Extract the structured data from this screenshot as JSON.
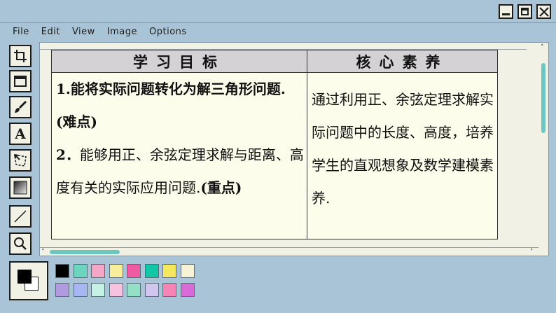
{
  "menu": [
    "File",
    "Edit",
    "View",
    "Image",
    "Options"
  ],
  "tools": [
    {
      "name": "select-tool",
      "icon": "crop-icon"
    },
    {
      "name": "rectangle-tool",
      "icon": "rectangle-icon"
    },
    {
      "name": "brush-tool",
      "icon": "brush-icon"
    },
    {
      "name": "text-tool",
      "icon": "text-icon",
      "glyph": "A"
    },
    {
      "name": "polygon-select-tool",
      "icon": "polygon-select-icon"
    },
    {
      "name": "gradient-tool",
      "icon": "gradient-icon"
    },
    {
      "name": "line-tool",
      "icon": "line-icon"
    },
    {
      "name": "zoom-tool",
      "icon": "magnifier-icon"
    }
  ],
  "slide": {
    "header_left": "学习目标",
    "header_right": "核心素养",
    "goal1_text": "1.能将实际问题转化为解三角形问题.",
    "goal1_tag": "(难点)",
    "goal2_num": "2．",
    "goal2_text": "能够用正、余弦定理求解与距离、高度有关的实际应用问题.",
    "goal2_tag": "(重点)",
    "core_text": "通过利用正、余弦定理求解实际问题中的长度、高度，培养学生的直观想象及数学建模素养."
  },
  "palette": {
    "foreground": "#000000",
    "background": "#ffffff",
    "colors_row1": [
      "#000000",
      "#6ad6c0",
      "#f4a6c6",
      "#f6ee9c",
      "#ee5ba0",
      "#12c7a3",
      "#f6e85e",
      "#f7f2d5"
    ],
    "colors_row2": [
      "#b29ae0",
      "#a9b6f4",
      "#c5f2e4",
      "#f6c2dd",
      "#93e0c6",
      "#d2c6f0",
      "#f684b5",
      "#d96bd8"
    ]
  },
  "accent": "#6cc7c1"
}
